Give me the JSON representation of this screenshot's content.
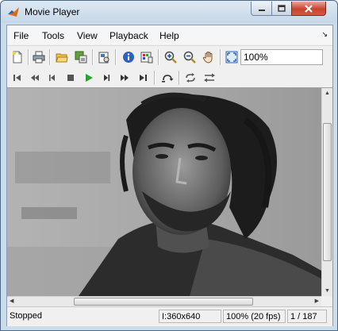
{
  "window": {
    "title": "Movie Player"
  },
  "menu": {
    "items": [
      "File",
      "Tools",
      "View",
      "Playback",
      "Help"
    ]
  },
  "toolbar": {
    "zoom_value": "100%",
    "icons": [
      "new-icon",
      "print-icon",
      "open-folder-icon",
      "export-icon",
      "properties-icon",
      "info-icon",
      "colormap-icon",
      "zoom-in-icon",
      "zoom-out-icon",
      "pan-hand-icon",
      "fit-to-window-icon"
    ]
  },
  "playback": {
    "icons": [
      "go-to-first-icon",
      "step-back-large-icon",
      "step-back-icon",
      "stop-icon",
      "play-icon",
      "step-forward-icon",
      "step-forward-large-icon",
      "go-to-last-icon",
      "jump-to-icon",
      "repeat-icon",
      "forward-backward-icon"
    ]
  },
  "status": {
    "state": "Stopped",
    "dimensions": "I:360x640",
    "zoom_fps": "100% (20 fps)",
    "frame": "1 / 187"
  },
  "colors": {
    "title_gradient_top": "#dfe9f3",
    "close_button": "#c8432e",
    "play_green": "#2aa12a"
  }
}
